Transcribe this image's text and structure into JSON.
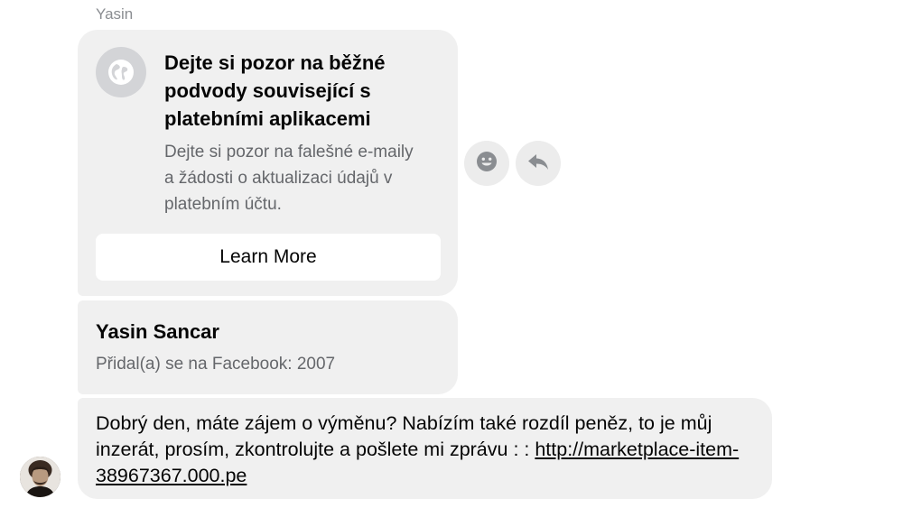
{
  "conversation": {
    "sender_name": "Yasin"
  },
  "warning_card": {
    "icon": "globe-icon",
    "title": "Dejte si pozor na běžné podvody související s platebními aplikacemi",
    "body": "Dejte si pozor na falešné e-maily a žádosti o aktualizaci údajů v platebním účtu.",
    "button_label": "Learn More"
  },
  "message_tools": {
    "react_icon": "smiley-icon",
    "reply_icon": "reply-icon"
  },
  "profile_card": {
    "name": "Yasin Sancar",
    "joined": "Přidal(a) se na Facebook: 2007"
  },
  "message": {
    "text": "Dobrý den, máte zájem o výměnu? Nabízím také rozdíl peněz, to je můj inzerát, prosím, zkontrolujte a pošlete mi zprávu : : ",
    "link": "http://marketplace-item-38967367.000.pe"
  },
  "avatar": {
    "icon": "avatar-photo"
  },
  "colors": {
    "bubble_bg": "#f0f0f0",
    "secondary_text": "#65676b",
    "sender_name": "#8a8d91",
    "icon_bg": "#d3d4d7"
  }
}
